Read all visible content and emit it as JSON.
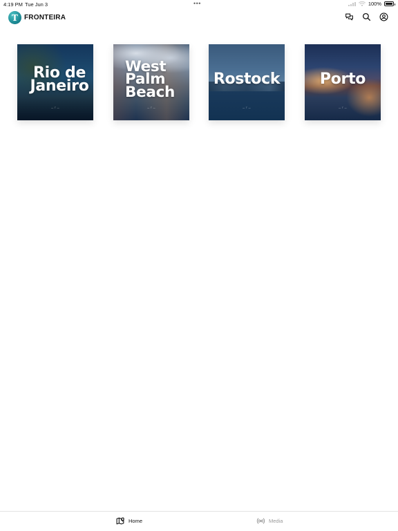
{
  "status_bar": {
    "time": "4:19 PM",
    "date": "Tue Jun 3",
    "dots": "•••",
    "battery_percent": "100%",
    "battery_level": 1.0
  },
  "header": {
    "logo_letter": "T",
    "app_name": "FRONTEIRA",
    "icons": [
      "chat-icon",
      "search-icon",
      "account-icon"
    ]
  },
  "destinations": [
    {
      "title": "Rio de\nJaneiro"
    },
    {
      "title": "West\nPalm\nBeach"
    },
    {
      "title": "Rostock"
    },
    {
      "title": "Porto"
    }
  ],
  "tab_bar": {
    "tabs": [
      {
        "label": "Home",
        "icon": "map-pin-icon",
        "active": true
      },
      {
        "label": "Media",
        "icon": "broadcast-icon",
        "active": false
      }
    ]
  },
  "colors": {
    "accent": "#1e8f98",
    "active_tab": "#111111",
    "inactive_tab": "#9a9a9a"
  }
}
